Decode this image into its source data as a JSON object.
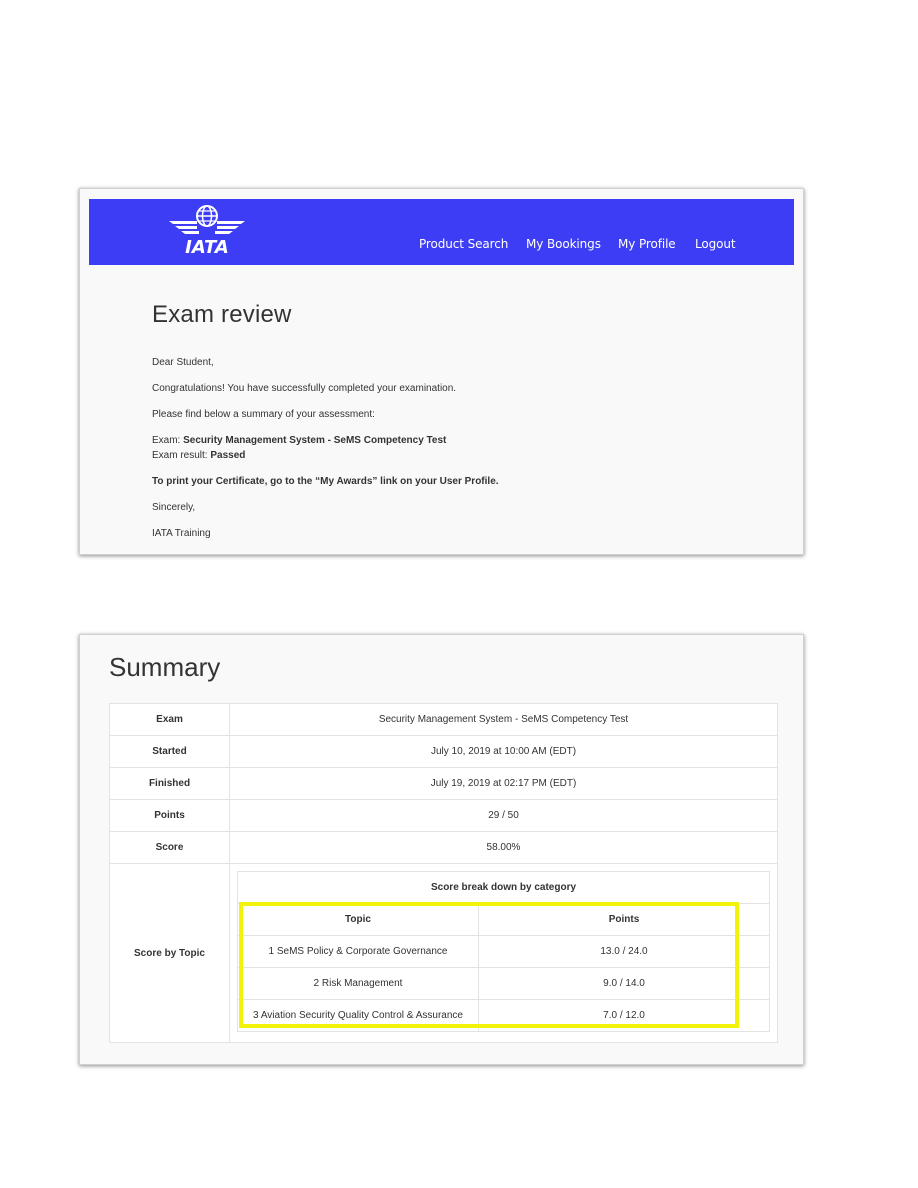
{
  "header": {
    "logo_text": "IATA",
    "nav": [
      "Product Search",
      "My Bookings",
      "My Profile",
      "Logout"
    ]
  },
  "review": {
    "title": "Exam review",
    "greeting": "Dear Student,",
    "congrats": "Congratulations!  You have successfully completed your examination.",
    "summary_intro": "Please find below a summary of your assessment:",
    "exam_label": "Exam: ",
    "exam_name": "Security Management System - SeMS Competency Test",
    "result_label": "Exam result: ",
    "result_value": "Passed",
    "print_note": "To print your Certificate, go to the “My Awards” link on your User Profile.",
    "sincerely": "Sincerely,",
    "signature": "IATA Training"
  },
  "summary": {
    "title": "Summary",
    "rows": [
      {
        "label": "Exam",
        "value": "Security Management System - SeMS Competency Test"
      },
      {
        "label": "Started",
        "value": "July 10, 2019 at 10:00 AM (EDT)"
      },
      {
        "label": "Finished",
        "value": "July 19, 2019 at 02:17 PM (EDT)"
      },
      {
        "label": "Points",
        "value": "29 / 50"
      },
      {
        "label": "Score",
        "value": "58.00%"
      }
    ],
    "topic_label": "Score by Topic",
    "breakdown_title": "Score break down by category",
    "topic_header": "Topic",
    "points_header": "Points",
    "topics": [
      {
        "topic": "1 SeMS Policy & Corporate Governance",
        "points": "13.0 / 24.0"
      },
      {
        "topic": "2 Risk Management",
        "points": "9.0 / 14.0"
      },
      {
        "topic": "3 Aviation Security Quality Control & Assurance",
        "points": "7.0 / 12.0"
      }
    ],
    "highlight_color": "#f2f20a"
  },
  "colors": {
    "header_bg": "#3d3df5"
  }
}
